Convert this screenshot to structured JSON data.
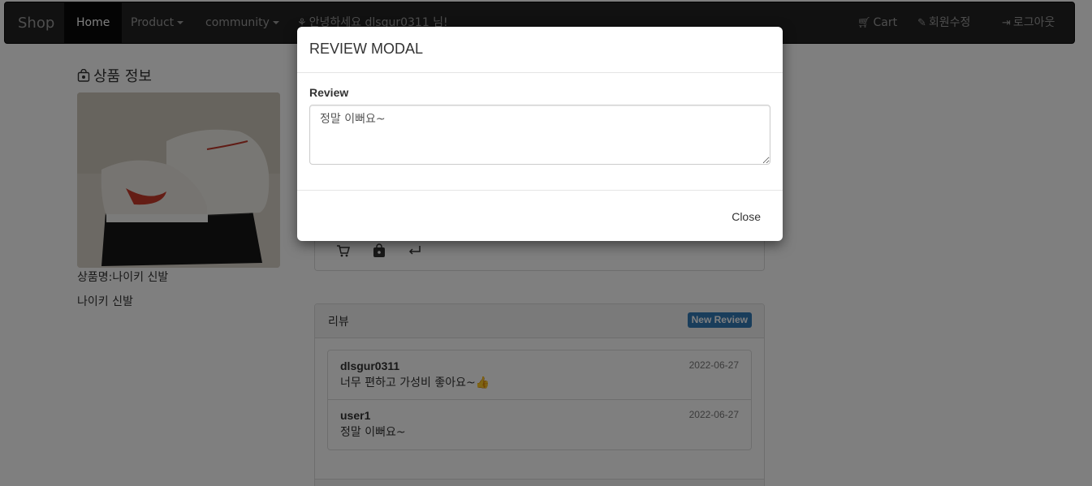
{
  "navbar": {
    "brand": "Shop",
    "home": "Home",
    "product": "Product",
    "community": "community",
    "greeting": "안녕하세요 dlsgur0311 님!",
    "cart": "Cart",
    "edit_profile": "회원수정",
    "logout": "로그아웃"
  },
  "product": {
    "section_title": "상품 정보",
    "name_line": "상품명:나이키 신발",
    "description": "나이키 신발"
  },
  "reviews": {
    "heading": "리뷰",
    "new_review_label": "New Review",
    "items": [
      {
        "user": "dlsgur0311",
        "text": "너무 편하고 가성비 좋아요~👍",
        "date": "2022-06-27"
      },
      {
        "user": "user1",
        "text": "정말 이뻐요~",
        "date": "2022-06-27"
      }
    ]
  },
  "modal": {
    "title": "REVIEW MODAL",
    "field_label": "Review",
    "textarea_value": "정말 이뻐요~",
    "close_label": "Close"
  },
  "colors": {
    "navbar_bg": "#222222",
    "primary": "#337ab7",
    "backdrop": "rgba(0,0,0,0.5)"
  }
}
